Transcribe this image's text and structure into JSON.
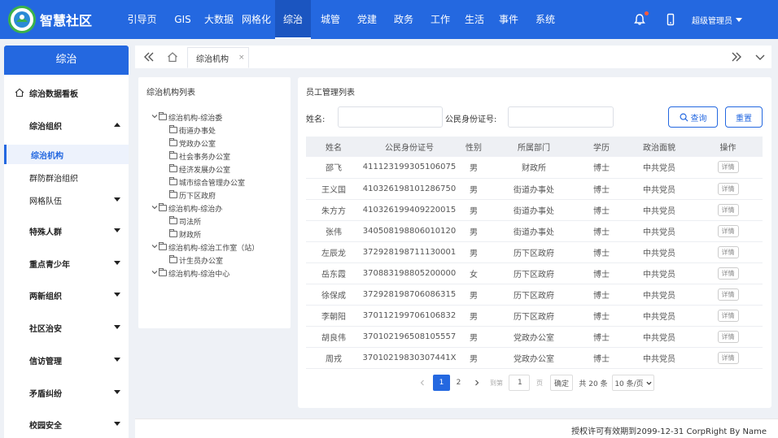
{
  "app": {
    "title": "智慧社区"
  },
  "nav": {
    "items": [
      "引导页",
      "GIS",
      "大数据",
      "网格化",
      "综治",
      "城管",
      "党建",
      "政务",
      "工作",
      "生活",
      "事件",
      "系统"
    ],
    "active": "综治"
  },
  "header": {
    "user": "超级管理员"
  },
  "sidebar": {
    "title": "综治",
    "items": [
      {
        "label": "综治数据看板",
        "type": "home"
      },
      {
        "label": "综治组织",
        "type": "group-open"
      },
      {
        "label": "综治机构",
        "type": "active"
      },
      {
        "label": "群防群治组织",
        "type": "sub"
      },
      {
        "label": "网格队伍",
        "type": "sub-arrow"
      },
      {
        "label": "特殊人群",
        "type": "group"
      },
      {
        "label": "重点青少年",
        "type": "group"
      },
      {
        "label": "两新组织",
        "type": "group"
      },
      {
        "label": "社区治安",
        "type": "group"
      },
      {
        "label": "信访管理",
        "type": "group"
      },
      {
        "label": "矛盾纠纷",
        "type": "group"
      },
      {
        "label": "校园安全",
        "type": "group"
      }
    ]
  },
  "tabs": {
    "current": "综治机构",
    "close": "×"
  },
  "tree": {
    "title": "综治机构列表",
    "nodes": [
      {
        "label": "综治机构-综治委",
        "level": 0,
        "open": true
      },
      {
        "label": "街道办事处",
        "level": 1
      },
      {
        "label": "党政办公室",
        "level": 1
      },
      {
        "label": "社会事务办公室",
        "level": 1
      },
      {
        "label": "经济发展办公室",
        "level": 1
      },
      {
        "label": "城市综合管理办公室",
        "level": 1
      },
      {
        "label": "历下区政府",
        "level": 1
      },
      {
        "label": "综治机构-综治办",
        "level": 0,
        "open": true
      },
      {
        "label": "司法所",
        "level": 1
      },
      {
        "label": "财政所",
        "level": 1
      },
      {
        "label": "综治机构-综治工作室（站）",
        "level": 0,
        "open": true
      },
      {
        "label": "计生员办公室",
        "level": 1
      },
      {
        "label": "综治机构-综治中心",
        "level": 0,
        "open": true
      }
    ]
  },
  "staff": {
    "title": "员工管理列表",
    "search": {
      "name_label": "姓名:",
      "id_label": "公民身份证号:",
      "query_label": "查询",
      "reset_label": "重置"
    },
    "columns": [
      "姓名",
      "公民身份证号",
      "性别",
      "所属部门",
      "学历",
      "政治面貌",
      "操作"
    ],
    "rows": [
      [
        "邵飞",
        "411123199305106075",
        "男",
        "财政所",
        "博士",
        "中共党员",
        "详情"
      ],
      [
        "王义国",
        "410326198101286750",
        "男",
        "街道办事处",
        "博士",
        "中共党员",
        "详情"
      ],
      [
        "朱方方",
        "410326199409220015",
        "男",
        "街道办事处",
        "博士",
        "中共党员",
        "详情"
      ],
      [
        "张伟",
        "340508198806010120",
        "男",
        "街道办事处",
        "博士",
        "中共党员",
        "详情"
      ],
      [
        "左辰龙",
        "372928198711130001",
        "男",
        "历下区政府",
        "博士",
        "中共党员",
        "详情"
      ],
      [
        "岳东霞",
        "370883198805200000",
        "女",
        "历下区政府",
        "博士",
        "中共党员",
        "详情"
      ],
      [
        "徐保成",
        "372928198706086315",
        "男",
        "历下区政府",
        "博士",
        "中共党员",
        "详情"
      ],
      [
        "李朝阳",
        "370112199706106832",
        "男",
        "历下区政府",
        "博士",
        "中共党员",
        "详情"
      ],
      [
        "胡良伟",
        "370102196508105557",
        "男",
        "党政办公室",
        "博士",
        "中共党员",
        "详情"
      ],
      [
        "周戎",
        "37010219830307441X",
        "男",
        "党政办公室",
        "博士",
        "中共党员",
        "详情"
      ]
    ],
    "pagination": {
      "pages": [
        "1",
        "2"
      ],
      "current": "1",
      "goto_label": "到第",
      "goto_value": "1",
      "page_unit": "页",
      "confirm": "确定",
      "total": "共 20 条",
      "page_size": "10 条/页"
    }
  },
  "footer": {
    "text": "授权许可有效期到2099-12-31 CorpRight By Name"
  },
  "colors": {
    "primary": "#2468e0",
    "logo_green": "#3bb24a",
    "badge": "#ff5a3a"
  }
}
